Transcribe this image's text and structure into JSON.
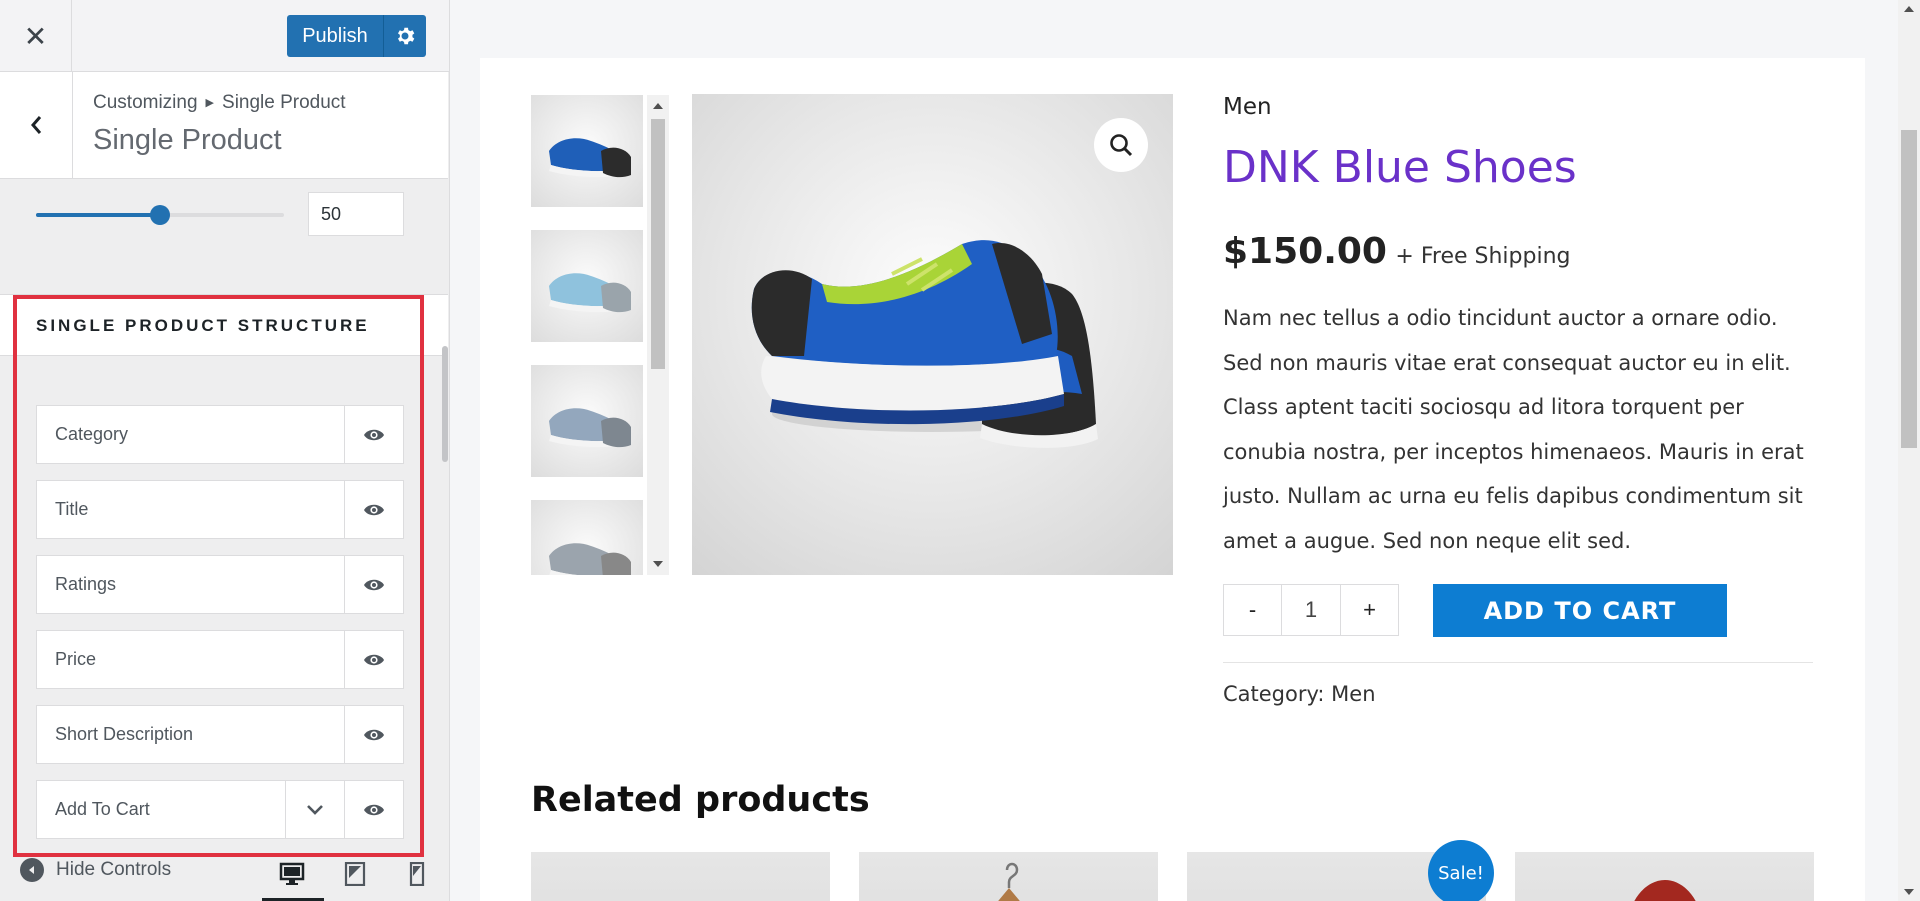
{
  "topbar": {
    "publish_label": "Publish"
  },
  "section": {
    "breadcrumb_root": "Customizing",
    "breadcrumb_current": "Single Product",
    "title": "Single Product"
  },
  "slider": {
    "value": "50",
    "fraction": 0.5
  },
  "structure": {
    "title": "SINGLE PRODUCT STRUCTURE",
    "items": [
      {
        "label": "Category"
      },
      {
        "label": "Title"
      },
      {
        "label": "Ratings"
      },
      {
        "label": "Price"
      },
      {
        "label": "Short Description"
      },
      {
        "label": "Add To Cart"
      }
    ]
  },
  "footer": {
    "hide_controls": "Hide Controls"
  },
  "product": {
    "category": "Men",
    "title": "DNK Blue Shoes",
    "price": "$150.00",
    "price_suffix": "+ Free Shipping",
    "description": "Nam nec tellus a odio tincidunt auctor a ornare odio. Sed non mauris vitae erat consequat auctor eu in elit. Class aptent taciti sociosqu ad litora torquent per conubia nostra, per inceptos himenaeos. Mauris in erat justo. Nullam ac urna eu felis dapibus condimentum sit amet a augue. Sed non neque elit sed.",
    "qty_minus": "-",
    "quantity": "1",
    "qty_plus": "+",
    "add_to_cart": "ADD TO CART",
    "meta_label": "Category:",
    "meta_value": "Men"
  },
  "related": {
    "title": "Related products",
    "sale_badge": "Sale!"
  },
  "colors": {
    "accent": "#2271b1",
    "title_purple": "#6a31c9",
    "cart_blue": "#0d7dd2",
    "highlight_red": "#e03140"
  },
  "icons": [
    "close-icon",
    "gear-icon",
    "chevron-left-icon",
    "eye-icon",
    "chevron-down-icon",
    "arrow-left-circle-icon",
    "desktop-icon",
    "tablet-icon",
    "mobile-icon",
    "search-icon"
  ]
}
